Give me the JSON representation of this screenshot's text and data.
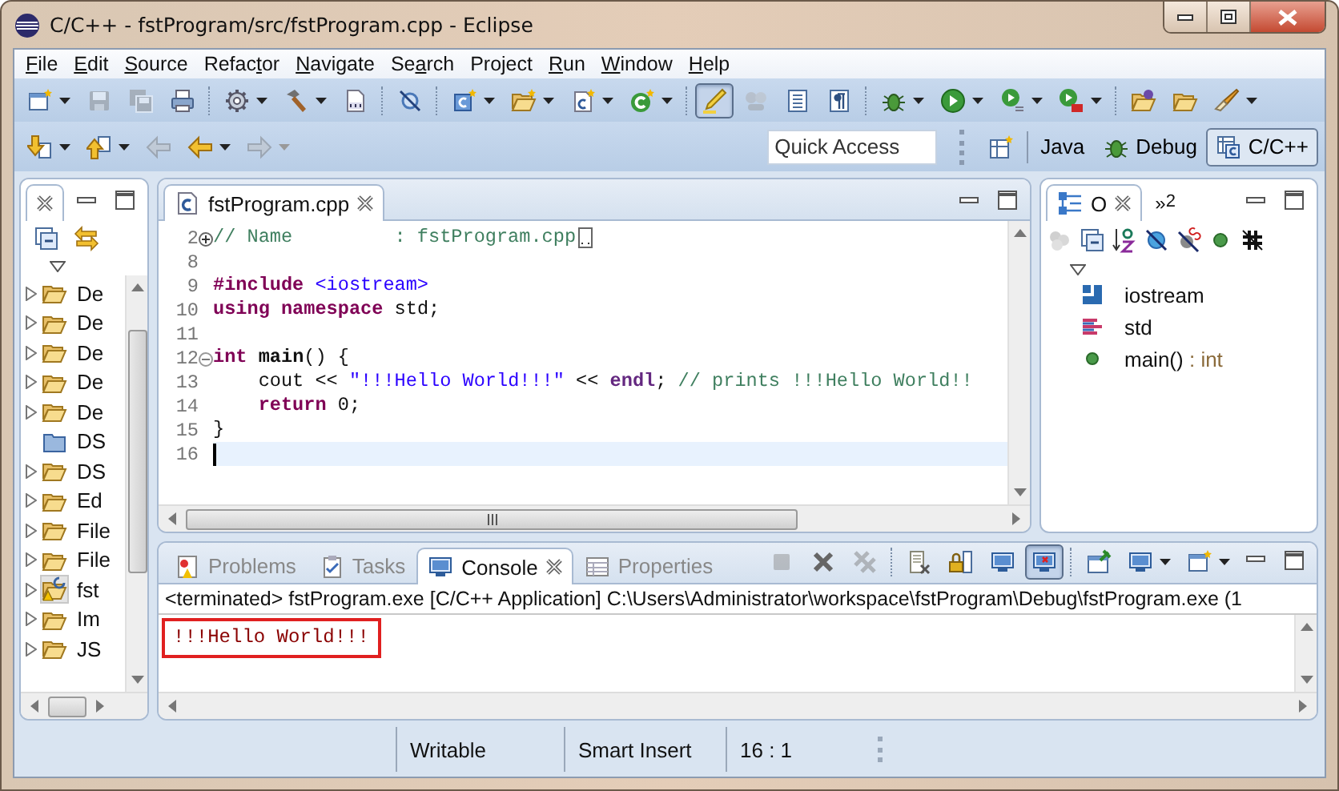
{
  "window": {
    "title": "C/C++ - fstProgram/src/fstProgram.cpp - Eclipse"
  },
  "menu": [
    {
      "key": "F",
      "post": "ile"
    },
    {
      "key": "E",
      "post": "dit"
    },
    {
      "key": "S",
      "post": "ource"
    },
    {
      "pre": "Refac",
      "key": "t",
      "post": "or"
    },
    {
      "key": "N",
      "post": "avigate"
    },
    {
      "pre": "Se",
      "key": "a",
      "post": "rch"
    },
    {
      "pre": "Pro",
      "key": "j",
      "post": "ect"
    },
    {
      "key": "R",
      "post": "un"
    },
    {
      "key": "W",
      "post": "indow"
    },
    {
      "key": "H",
      "post": "elp"
    }
  ],
  "toolbar_rows": [
    [
      [
        {
          "kind": "new-window",
          "dropdown": true,
          "disabled": false,
          "selected": false
        },
        {
          "kind": "save",
          "dropdown": false,
          "disabled": true,
          "selected": false
        },
        {
          "kind": "save-all",
          "dropdown": false,
          "disabled": true,
          "selected": false
        },
        {
          "kind": "print",
          "dropdown": false,
          "disabled": false,
          "selected": false
        }
      ],
      [
        {
          "kind": "gear",
          "dropdown": true,
          "disabled": false,
          "selected": false
        },
        {
          "kind": "hammer",
          "dropdown": true,
          "disabled": false,
          "selected": false
        },
        {
          "kind": "binary",
          "dropdown": false,
          "disabled": false,
          "selected": false
        }
      ],
      [
        {
          "kind": "no-search",
          "dropdown": false,
          "disabled": false,
          "selected": false
        }
      ],
      [
        {
          "kind": "new-class",
          "dropdown": true,
          "disabled": false,
          "selected": false
        },
        {
          "kind": "new-folder",
          "dropdown": true,
          "disabled": false,
          "selected": false
        },
        {
          "kind": "new-file",
          "dropdown": true,
          "disabled": false,
          "selected": false
        },
        {
          "kind": "new-project",
          "dropdown": true,
          "disabled": false,
          "selected": false
        }
      ],
      [
        {
          "kind": "pen",
          "dropdown": false,
          "disabled": false,
          "selected": true
        },
        {
          "kind": "spotlight",
          "dropdown": false,
          "disabled": true,
          "selected": false
        },
        {
          "kind": "block",
          "dropdown": false,
          "disabled": false,
          "selected": false
        },
        {
          "kind": "pilcrow",
          "dropdown": false,
          "disabled": false,
          "selected": false
        }
      ],
      [
        {
          "kind": "bug",
          "dropdown": true,
          "disabled": false,
          "selected": false
        },
        {
          "kind": "run",
          "dropdown": true,
          "disabled": false,
          "selected": false
        },
        {
          "kind": "run-config",
          "dropdown": true,
          "disabled": false,
          "selected": false
        },
        {
          "kind": "tools",
          "dropdown": true,
          "disabled": false,
          "selected": false
        }
      ],
      [
        {
          "kind": "folder-globe",
          "dropdown": false,
          "disabled": false,
          "selected": false
        },
        {
          "kind": "folder",
          "dropdown": false,
          "disabled": false,
          "selected": false
        },
        {
          "kind": "brush",
          "dropdown": true,
          "disabled": false,
          "selected": false
        }
      ]
    ],
    [
      [
        {
          "kind": "next-annotation",
          "dropdown": true,
          "disabled": false,
          "selected": false
        },
        {
          "kind": "prev-annotation",
          "dropdown": true,
          "disabled": false,
          "selected": false
        },
        {
          "kind": "back",
          "dropdown": false,
          "disabled": true,
          "selected": false
        },
        {
          "kind": "back",
          "dropdown": true,
          "disabled": false,
          "selected": false
        },
        {
          "kind": "forward",
          "dropdown": true,
          "disabled": true,
          "selected": false
        }
      ]
    ]
  ],
  "quick_access": {
    "placeholder": "Quick Access"
  },
  "perspectives": [
    {
      "kind": "open",
      "selected": false
    },
    {
      "kind": "plain",
      "label": "Java",
      "selected": false
    },
    {
      "kind": "bug",
      "label": "Debug",
      "selected": false
    },
    {
      "kind": "c-grid",
      "label": "C/C++",
      "selected": true
    }
  ],
  "left_panel": {
    "tab": {
      "selected": true
    },
    "toolbar": [
      {
        "kind": "collapse",
        "dropdown": false,
        "disabled": false,
        "selected": false
      },
      {
        "kind": "link",
        "dropdown": false,
        "disabled": false,
        "selected": false
      }
    ],
    "items": [
      {
        "label": "De",
        "kind": "open-folder",
        "expandable": true,
        "selected": false
      },
      {
        "label": "De",
        "kind": "open-folder",
        "expandable": true,
        "selected": false
      },
      {
        "label": "De",
        "kind": "open-folder",
        "expandable": true,
        "selected": false
      },
      {
        "label": "De",
        "kind": "open-folder",
        "expandable": true,
        "selected": false
      },
      {
        "label": "De",
        "kind": "open-folder",
        "expandable": true,
        "selected": false
      },
      {
        "label": "DS",
        "kind": "closed-folder",
        "expandable": false,
        "selected": false
      },
      {
        "label": "DS",
        "kind": "open-folder",
        "expandable": true,
        "selected": false
      },
      {
        "label": "Ed",
        "kind": "open-folder",
        "expandable": true,
        "selected": false
      },
      {
        "label": "File",
        "kind": "open-folder",
        "expandable": true,
        "selected": false
      },
      {
        "label": "File",
        "kind": "open-folder",
        "expandable": true,
        "selected": false
      },
      {
        "label": "fst",
        "kind": "project",
        "expandable": true,
        "selected": true
      },
      {
        "label": "Im",
        "kind": "open-folder",
        "expandable": true,
        "selected": false
      },
      {
        "label": "JS",
        "kind": "open-folder",
        "expandable": true,
        "selected": false
      }
    ]
  },
  "editor": {
    "tabs": [
      {
        "label": "fstProgram.cpp",
        "selected": true
      }
    ],
    "lines": [
      {
        "number": "2",
        "kind": "collapsed-fold",
        "current": false,
        "tokens": [
          {
            "kind": "comment",
            "text": "// Name         : fstProgram.cpp"
          }
        ]
      },
      {
        "number": "8",
        "kind": "plain",
        "current": false
      },
      {
        "number": "9",
        "kind": "plain",
        "current": false,
        "tokens": [
          {
            "kind": "keyword",
            "text": "#include"
          },
          {
            "kind": "include",
            "text": " <iostream>"
          }
        ]
      },
      {
        "number": "10",
        "kind": "plain",
        "current": false,
        "tokens": [
          {
            "kind": "keyword",
            "text": "using namespace"
          },
          {
            "kind": "plain",
            "text": " std;"
          }
        ]
      },
      {
        "number": "11",
        "kind": "plain",
        "current": false
      },
      {
        "number": "12",
        "kind": "expanded-fold",
        "current": false,
        "tokens": [
          {
            "kind": "keyword",
            "text": "int"
          },
          {
            "kind": "function",
            "text": " main"
          },
          {
            "kind": "plain",
            "text": "() {"
          }
        ]
      },
      {
        "number": "13",
        "kind": "plain",
        "current": false,
        "tokens": [
          {
            "kind": "plain",
            "text": "    cout << "
          },
          {
            "kind": "string",
            "text": "\"!!!Hello World!!!\""
          },
          {
            "kind": "plain",
            "text": " << "
          },
          {
            "kind": "field",
            "text": "endl"
          },
          {
            "kind": "plain",
            "text": "; "
          },
          {
            "kind": "comment",
            "text": "// prints !!!Hello World!!"
          }
        ]
      },
      {
        "number": "14",
        "kind": "plain",
        "current": false,
        "tokens": [
          {
            "kind": "keyword",
            "text": "    return"
          },
          {
            "kind": "plain",
            "text": " 0;"
          }
        ]
      },
      {
        "number": "15",
        "kind": "plain",
        "current": false,
        "tokens": [
          {
            "kind": "plain",
            "text": "}"
          }
        ]
      },
      {
        "number": "16",
        "kind": "plain",
        "current": true
      }
    ]
  },
  "outline": {
    "tabs": [
      {
        "label": "O",
        "selected": true
      }
    ],
    "overflow": {
      "chevron": "»",
      "count": "2"
    },
    "toolbar": [
      {
        "kind": "circles",
        "dropdown": false,
        "disabled": true,
        "selected": false
      },
      {
        "kind": "collapse",
        "dropdown": false,
        "disabled": false,
        "selected": false
      },
      {
        "kind": "sort",
        "dropdown": false,
        "disabled": false,
        "selected": false
      },
      {
        "kind": "hide-fields",
        "dropdown": false,
        "disabled": false,
        "selected": false
      },
      {
        "kind": "hide-static",
        "dropdown": false,
        "disabled": false,
        "selected": false
      },
      {
        "kind": "dot",
        "dropdown": false,
        "disabled": false,
        "selected": false
      },
      {
        "kind": "hash",
        "dropdown": false,
        "disabled": false,
        "selected": false
      }
    ],
    "items": [
      {
        "kind": "include",
        "label": "iostream"
      },
      {
        "kind": "namespace",
        "label": "std"
      },
      {
        "kind": "function",
        "label": "main()",
        "type": ": int"
      }
    ]
  },
  "console": {
    "tabs": [
      {
        "kind": "problems",
        "label": "Problems",
        "selected": false
      },
      {
        "kind": "tasks",
        "label": "Tasks",
        "selected": false
      },
      {
        "kind": "console",
        "label": "Console",
        "selected": true
      },
      {
        "kind": "properties",
        "label": "Properties",
        "selected": false
      }
    ],
    "toolbar": [
      [
        {
          "kind": "stop",
          "dropdown": false,
          "disabled": true,
          "selected": false
        },
        {
          "kind": "remove",
          "dropdown": false,
          "disabled": false,
          "selected": false
        },
        {
          "kind": "remove-all",
          "dropdown": false,
          "disabled": true,
          "selected": false
        }
      ],
      [
        {
          "kind": "clear",
          "dropdown": false,
          "disabled": false,
          "selected": false
        },
        {
          "kind": "lock",
          "dropdown": false,
          "disabled": false,
          "selected": false
        },
        {
          "kind": "show-out",
          "dropdown": false,
          "disabled": false,
          "selected": false
        },
        {
          "kind": "show-err",
          "dropdown": false,
          "disabled": false,
          "selected": true
        }
      ],
      [
        {
          "kind": "pin",
          "dropdown": false,
          "disabled": false,
          "selected": false
        },
        {
          "kind": "display",
          "dropdown": true,
          "disabled": false,
          "selected": false
        },
        {
          "kind": "new-window",
          "dropdown": true,
          "disabled": false,
          "selected": false
        }
      ]
    ],
    "process": "<terminated> fstProgram.exe [C/C++ Application] C:\\Users\\Administrator\\workspace\\fstProgram\\Debug\\fstProgram.exe (1",
    "output": [
      {
        "text": "!!!Hello World!!!",
        "boxed": true
      }
    ]
  },
  "status_bar": [
    "Writable",
    "Smart Insert",
    "16 : 1"
  ]
}
